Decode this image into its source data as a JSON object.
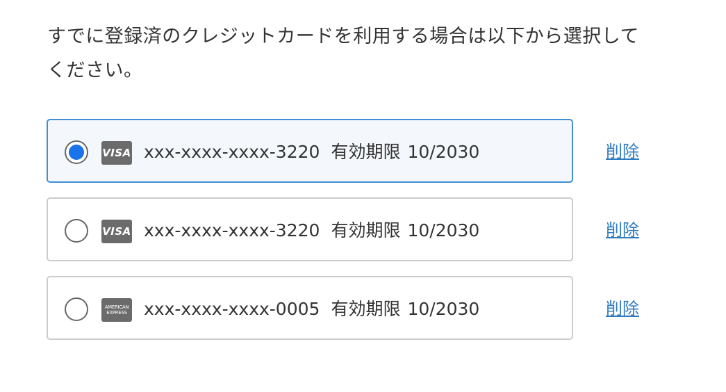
{
  "intro": {
    "line1": "すでに登録済のクレジットカードを利用する場合は以下から選択して",
    "line2": "ください。"
  },
  "cards": [
    {
      "brand": "VISA",
      "brand_icon": "visa-card-icon",
      "number": "xxx-xxxx-xxxx-3220",
      "expiry_label": "有効期限",
      "expiry": "10/2030",
      "delete_label": "削除",
      "selected": true
    },
    {
      "brand": "VISA",
      "brand_icon": "visa-card-icon",
      "number": "xxx-xxxx-xxxx-3220",
      "expiry_label": "有効期限",
      "expiry": "10/2030",
      "delete_label": "削除",
      "selected": false
    },
    {
      "brand": "AMERICAN EXPRESS",
      "brand_line1": "AMERICAN",
      "brand_line2": "EXPRESS",
      "brand_icon": "amex-card-icon",
      "number": "xxx-xxxx-xxxx-0005",
      "expiry_label": "有効期限",
      "expiry": "10/2030",
      "delete_label": "削除",
      "selected": false
    }
  ],
  "colors": {
    "selected_border": "#3f8fd2",
    "selected_background": "#f4f8fc",
    "radio_selected": "#1a73e8",
    "link": "#2f7bbf",
    "card_brand_background": "#6b6b6b"
  }
}
